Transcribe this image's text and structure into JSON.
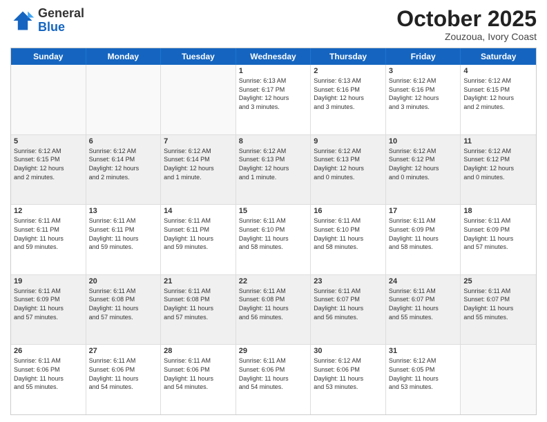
{
  "header": {
    "logo_general": "General",
    "logo_blue": "Blue",
    "month_title": "October 2025",
    "location": "Zouzoua, Ivory Coast"
  },
  "weekdays": [
    "Sunday",
    "Monday",
    "Tuesday",
    "Wednesday",
    "Thursday",
    "Friday",
    "Saturday"
  ],
  "rows": [
    [
      {
        "day": "",
        "info": "",
        "empty": true
      },
      {
        "day": "",
        "info": "",
        "empty": true
      },
      {
        "day": "",
        "info": "",
        "empty": true
      },
      {
        "day": "1",
        "info": "Sunrise: 6:13 AM\nSunset: 6:17 PM\nDaylight: 12 hours\nand 3 minutes."
      },
      {
        "day": "2",
        "info": "Sunrise: 6:13 AM\nSunset: 6:16 PM\nDaylight: 12 hours\nand 3 minutes."
      },
      {
        "day": "3",
        "info": "Sunrise: 6:12 AM\nSunset: 6:16 PM\nDaylight: 12 hours\nand 3 minutes."
      },
      {
        "day": "4",
        "info": "Sunrise: 6:12 AM\nSunset: 6:15 PM\nDaylight: 12 hours\nand 2 minutes."
      }
    ],
    [
      {
        "day": "5",
        "info": "Sunrise: 6:12 AM\nSunset: 6:15 PM\nDaylight: 12 hours\nand 2 minutes.",
        "shaded": true
      },
      {
        "day": "6",
        "info": "Sunrise: 6:12 AM\nSunset: 6:14 PM\nDaylight: 12 hours\nand 2 minutes.",
        "shaded": true
      },
      {
        "day": "7",
        "info": "Sunrise: 6:12 AM\nSunset: 6:14 PM\nDaylight: 12 hours\nand 1 minute.",
        "shaded": true
      },
      {
        "day": "8",
        "info": "Sunrise: 6:12 AM\nSunset: 6:13 PM\nDaylight: 12 hours\nand 1 minute.",
        "shaded": true
      },
      {
        "day": "9",
        "info": "Sunrise: 6:12 AM\nSunset: 6:13 PM\nDaylight: 12 hours\nand 0 minutes.",
        "shaded": true
      },
      {
        "day": "10",
        "info": "Sunrise: 6:12 AM\nSunset: 6:12 PM\nDaylight: 12 hours\nand 0 minutes.",
        "shaded": true
      },
      {
        "day": "11",
        "info": "Sunrise: 6:12 AM\nSunset: 6:12 PM\nDaylight: 12 hours\nand 0 minutes.",
        "shaded": true
      }
    ],
    [
      {
        "day": "12",
        "info": "Sunrise: 6:11 AM\nSunset: 6:11 PM\nDaylight: 11 hours\nand 59 minutes."
      },
      {
        "day": "13",
        "info": "Sunrise: 6:11 AM\nSunset: 6:11 PM\nDaylight: 11 hours\nand 59 minutes."
      },
      {
        "day": "14",
        "info": "Sunrise: 6:11 AM\nSunset: 6:11 PM\nDaylight: 11 hours\nand 59 minutes."
      },
      {
        "day": "15",
        "info": "Sunrise: 6:11 AM\nSunset: 6:10 PM\nDaylight: 11 hours\nand 58 minutes."
      },
      {
        "day": "16",
        "info": "Sunrise: 6:11 AM\nSunset: 6:10 PM\nDaylight: 11 hours\nand 58 minutes."
      },
      {
        "day": "17",
        "info": "Sunrise: 6:11 AM\nSunset: 6:09 PM\nDaylight: 11 hours\nand 58 minutes."
      },
      {
        "day": "18",
        "info": "Sunrise: 6:11 AM\nSunset: 6:09 PM\nDaylight: 11 hours\nand 57 minutes."
      }
    ],
    [
      {
        "day": "19",
        "info": "Sunrise: 6:11 AM\nSunset: 6:09 PM\nDaylight: 11 hours\nand 57 minutes.",
        "shaded": true
      },
      {
        "day": "20",
        "info": "Sunrise: 6:11 AM\nSunset: 6:08 PM\nDaylight: 11 hours\nand 57 minutes.",
        "shaded": true
      },
      {
        "day": "21",
        "info": "Sunrise: 6:11 AM\nSunset: 6:08 PM\nDaylight: 11 hours\nand 57 minutes.",
        "shaded": true
      },
      {
        "day": "22",
        "info": "Sunrise: 6:11 AM\nSunset: 6:08 PM\nDaylight: 11 hours\nand 56 minutes.",
        "shaded": true
      },
      {
        "day": "23",
        "info": "Sunrise: 6:11 AM\nSunset: 6:07 PM\nDaylight: 11 hours\nand 56 minutes.",
        "shaded": true
      },
      {
        "day": "24",
        "info": "Sunrise: 6:11 AM\nSunset: 6:07 PM\nDaylight: 11 hours\nand 55 minutes.",
        "shaded": true
      },
      {
        "day": "25",
        "info": "Sunrise: 6:11 AM\nSunset: 6:07 PM\nDaylight: 11 hours\nand 55 minutes.",
        "shaded": true
      }
    ],
    [
      {
        "day": "26",
        "info": "Sunrise: 6:11 AM\nSunset: 6:06 PM\nDaylight: 11 hours\nand 55 minutes."
      },
      {
        "day": "27",
        "info": "Sunrise: 6:11 AM\nSunset: 6:06 PM\nDaylight: 11 hours\nand 54 minutes."
      },
      {
        "day": "28",
        "info": "Sunrise: 6:11 AM\nSunset: 6:06 PM\nDaylight: 11 hours\nand 54 minutes."
      },
      {
        "day": "29",
        "info": "Sunrise: 6:11 AM\nSunset: 6:06 PM\nDaylight: 11 hours\nand 54 minutes."
      },
      {
        "day": "30",
        "info": "Sunrise: 6:12 AM\nSunset: 6:06 PM\nDaylight: 11 hours\nand 53 minutes."
      },
      {
        "day": "31",
        "info": "Sunrise: 6:12 AM\nSunset: 6:05 PM\nDaylight: 11 hours\nand 53 minutes."
      },
      {
        "day": "",
        "info": "",
        "empty": true
      }
    ]
  ]
}
